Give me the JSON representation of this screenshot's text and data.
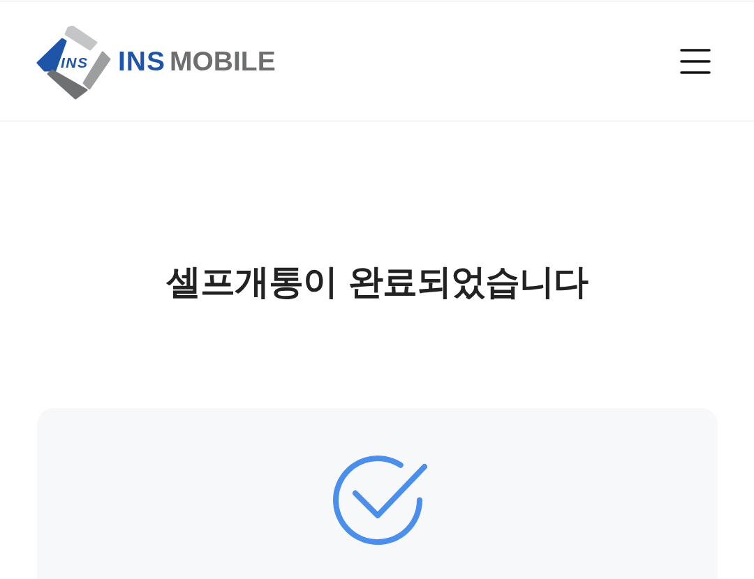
{
  "header": {
    "logo": {
      "mark_text": "INS",
      "name_primary": "INS",
      "name_secondary": "MOBILE"
    }
  },
  "title": "셀프개통이 완료되었습니다"
}
